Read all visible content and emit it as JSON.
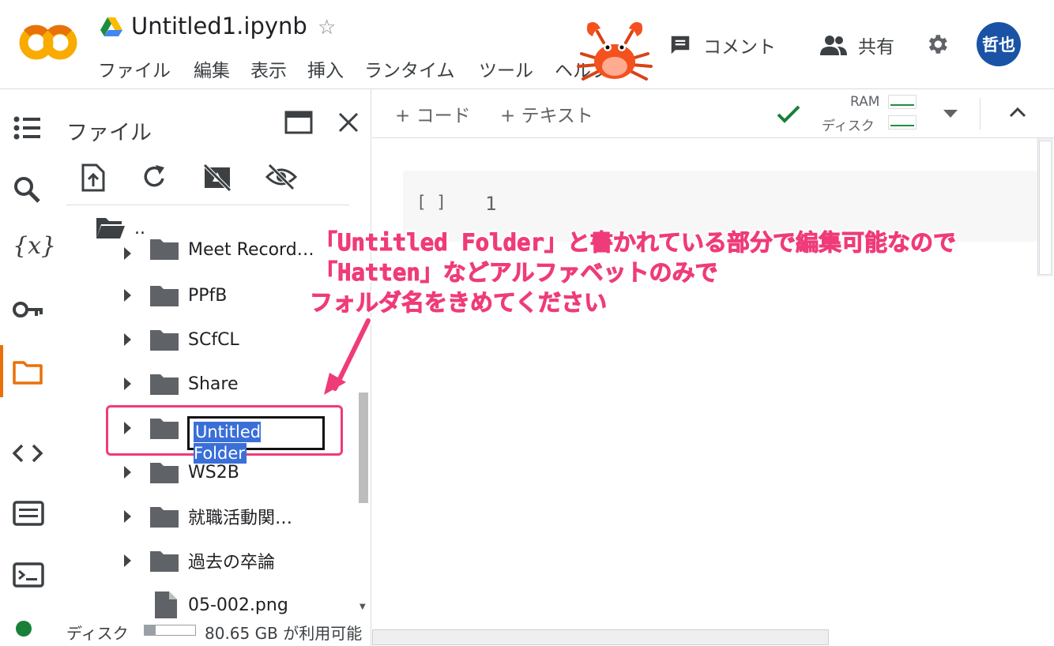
{
  "header": {
    "doc_title": "Untitled1.ipynb",
    "menus": [
      "ファイル",
      "編集",
      "表示",
      "挿入",
      "ランタイム",
      "ツール",
      "ヘルプ"
    ],
    "comment_label": "コメント",
    "share_label": "共有",
    "avatar_text": "哲也"
  },
  "file_panel": {
    "title": "ファイル",
    "parent_dir": "..",
    "items": [
      {
        "name": "Meet Record…",
        "type": "folder"
      },
      {
        "name": "PPfB",
        "type": "folder"
      },
      {
        "name": "SCfCL",
        "type": "folder"
      },
      {
        "name": "Share",
        "type": "folder"
      },
      {
        "name": "Untitled Folder",
        "type": "folder",
        "editing": true
      },
      {
        "name": "WS2B",
        "type": "folder"
      },
      {
        "name": "就職活動関…",
        "type": "folder"
      },
      {
        "name": "過去の卒論",
        "type": "folder"
      },
      {
        "name": "05-002.png",
        "type": "file"
      }
    ],
    "disk_label": "ディスク",
    "disk_free": "80.65 GB が利用可能",
    "disk_used_fraction": 0.22
  },
  "notebook": {
    "add_code": "+ コード",
    "add_text": "+ テキスト",
    "ram_label": "RAM",
    "disk_label": "ディスク",
    "cell_run": "[ ]",
    "cell_line": "1"
  },
  "annotation": {
    "line1_open": "「",
    "line1_code": "Untitled Folder",
    "line1_rest": "」と書かれている部分で編集可能なので",
    "line2_open": "「",
    "line2_code": "Hatten",
    "line2_rest": "」などアルファベットのみで",
    "line3": "フォルダ名をきめてください"
  },
  "colors": {
    "accent": "#e8710a",
    "annotation": "#ef3b7a",
    "selection": "#3a6fd8",
    "avatar": "#1a53a5",
    "connected": "#188038"
  }
}
